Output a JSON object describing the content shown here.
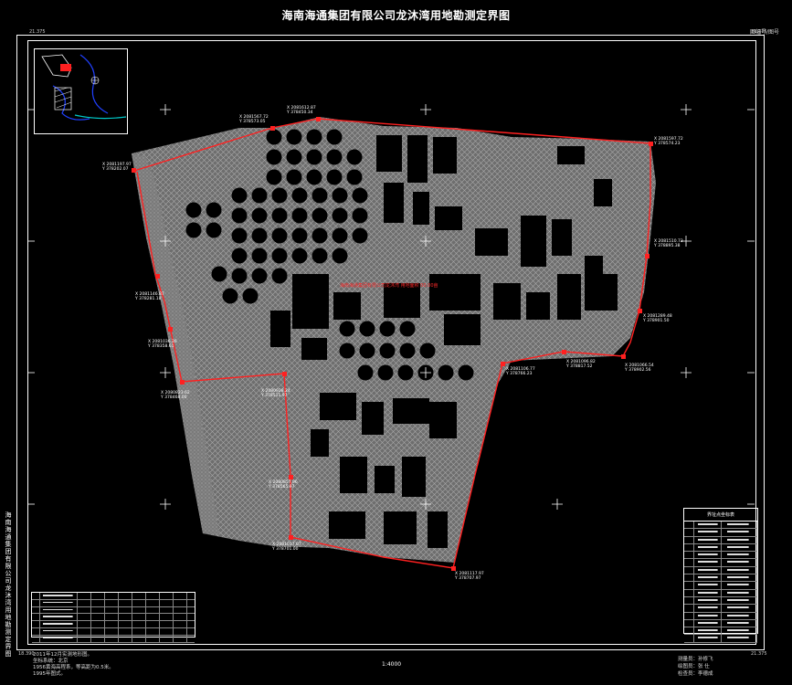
{
  "title": "海南海通集团有限公司龙沐湾用地勘测定界图",
  "side_title": "海南海通集团有限公司龙沐湾用地勘测定界图",
  "scale": "1:4000",
  "top_right_tag": "图幅号/图号",
  "corner_labels": [
    "21.375",
    "21.375",
    "18.390",
    "21.375"
  ],
  "center_label": "海南海通集团有限公司龙沐湾  用地面积 00.00亩",
  "notes": [
    "2011年12月实测地形图。",
    "坐标系统：北京",
    "1956黄海高程系，等高距为0.5米。",
    "1995年图式。"
  ],
  "signatures": [
    "测量员：孙修飞",
    "绘图员：张  仕",
    "检查员：李德成"
  ],
  "legend": {
    "title": "界址点坐标表",
    "rows": 16
  },
  "coordinate_labels": [
    {
      "x": "X 2081567.72",
      "y": "Y 378573.05"
    },
    {
      "x": "X 2081612.87",
      "y": "Y 378450.34"
    },
    {
      "x": "X 2081597.72",
      "y": "Y 378574.23"
    },
    {
      "x": "X 2081510.73",
      "y": "Y 378895.38"
    },
    {
      "x": "X 2081289.48",
      "y": "Y 378901.50"
    },
    {
      "x": "X 2081066.54",
      "y": "Y 378902.56"
    },
    {
      "x": "X 2081096.82",
      "y": "Y 378817.52"
    },
    {
      "x": "X 2081106.77",
      "y": "Y 378766.23"
    },
    {
      "x": "X 2081117.97",
      "y": "Y 378707.97"
    },
    {
      "x": "X 2081017.07",
      "y": "Y 378701.00"
    },
    {
      "x": "X 2080857.96",
      "y": "Y 378565.97"
    },
    {
      "x": "X 2080928.24",
      "y": "Y 378511.97"
    },
    {
      "x": "X 2080823.62",
      "y": "Y 378468.00"
    },
    {
      "x": "X 2081036.26",
      "y": "Y 378358.61"
    },
    {
      "x": "X 2081146.87",
      "y": "Y 378281.18"
    },
    {
      "x": "X 2081197.97",
      "y": "Y 378202.07"
    }
  ],
  "colors": {
    "background": "#000000",
    "boundary": "#ff2020",
    "terrain": "#8c8c8c",
    "buildings": "#000000",
    "frame": "#ffffff",
    "inset_road": "#2040ff",
    "inset_water": "#00c8c8"
  }
}
